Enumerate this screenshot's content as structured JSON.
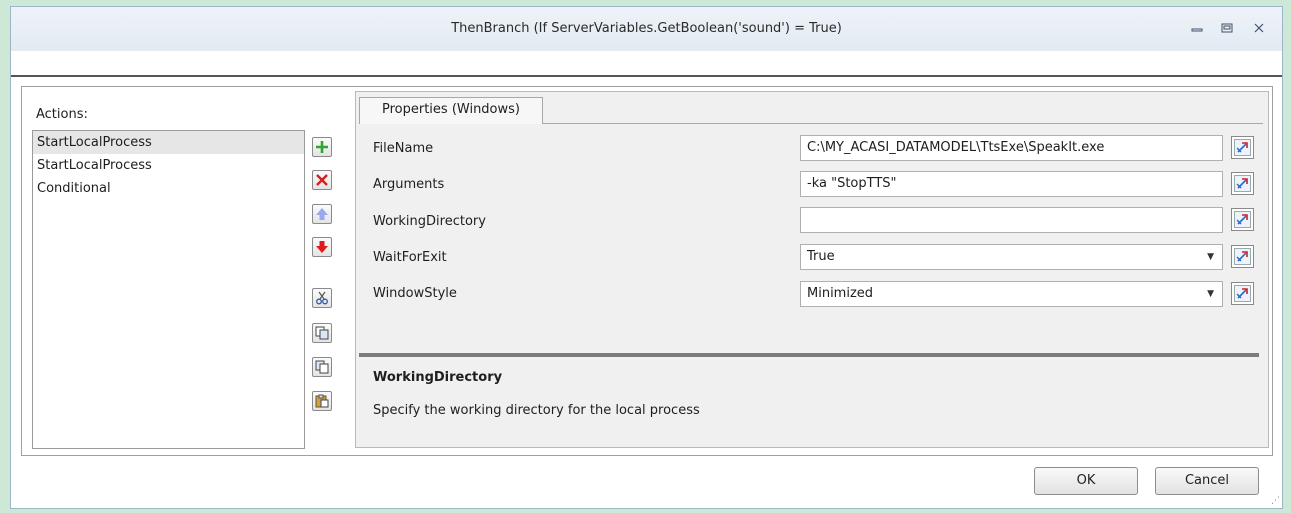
{
  "window": {
    "title": "ThenBranch (If ServerVariables.GetBoolean('sound') = True)"
  },
  "actions": {
    "label": "Actions:",
    "items": [
      "StartLocalProcess",
      "StartLocalProcess",
      "Conditional"
    ]
  },
  "tab": {
    "label": "Properties (Windows)"
  },
  "properties": [
    {
      "name": "FileName",
      "value": "C:\\MY_ACASI_DATAMODEL\\TtsExe\\SpeakIt.exe"
    },
    {
      "name": "Arguments",
      "value": "-ka \"StopTTS\""
    },
    {
      "name": "WorkingDirectory",
      "value": ""
    },
    {
      "name": "WaitForExit",
      "value": "True"
    },
    {
      "name": "WindowStyle",
      "value": "Minimized"
    }
  ],
  "description": {
    "title": "WorkingDirectory",
    "text": "Specify the working directory for the local process"
  },
  "buttons": {
    "ok": "OK",
    "cancel": "Cancel"
  },
  "colors": {
    "add": "#2ea82e",
    "delete": "#d42020",
    "up_disabled": "#9aa9ee",
    "down": "#e11b1b",
    "background": "#cde8d6"
  }
}
